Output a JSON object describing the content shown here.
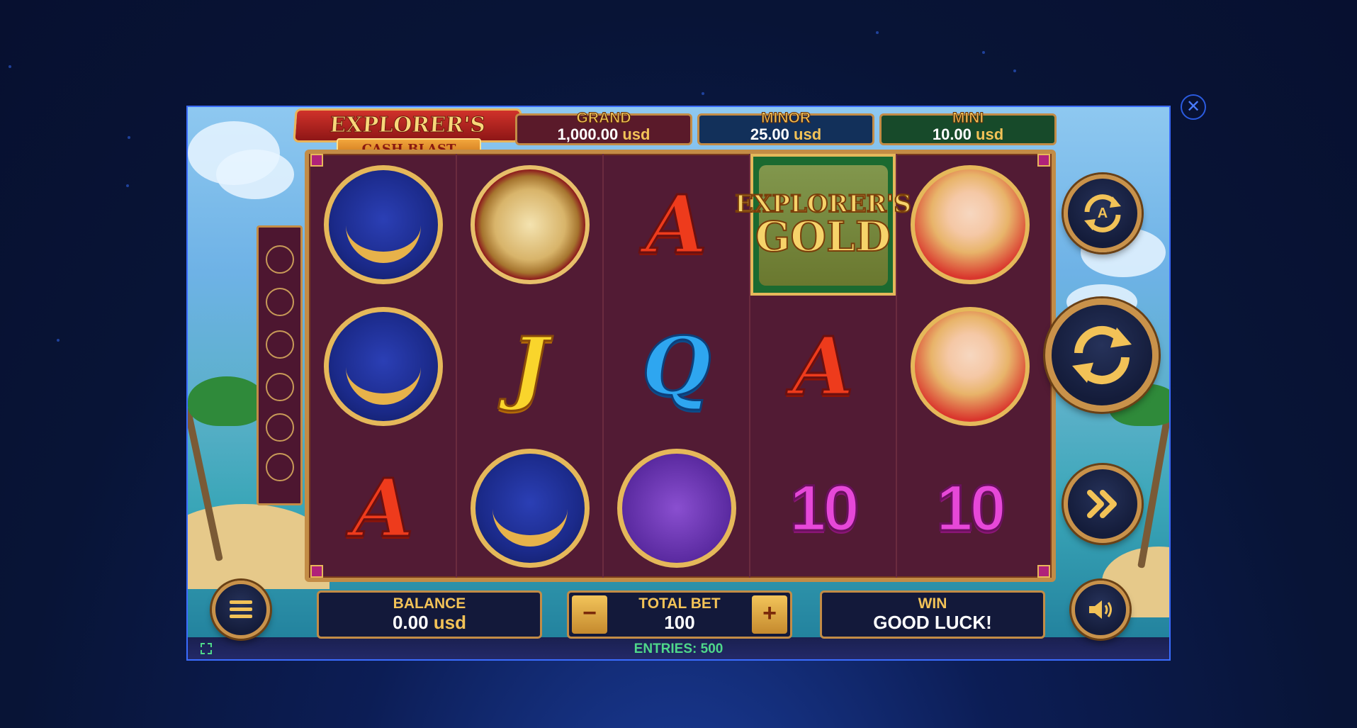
{
  "game": {
    "logo_line1": "EXPLORER'S GOLD",
    "logo_line2": "CASH BLAST"
  },
  "jackpots": [
    {
      "name": "GRAND",
      "amount": "1,000.00",
      "unit": "usd",
      "color": "#5a1a2a"
    },
    {
      "name": "MINOR",
      "amount": "25.00",
      "unit": "usd",
      "color": "#12305a"
    },
    {
      "name": "MINI",
      "amount": "10.00",
      "unit": "usd",
      "color": "#174a2a"
    }
  ],
  "reels": {
    "scatter_line1": "EXPLORER'S",
    "scatter_line2": "GOLD",
    "letter_a": "A",
    "letter_j": "J",
    "letter_q": "Q",
    "ten": "10"
  },
  "balance": {
    "label": "BALANCE",
    "amount": "0.00",
    "unit": "usd"
  },
  "bet": {
    "label": "TOTAL BET",
    "value": "100",
    "minus": "−",
    "plus": "+"
  },
  "win": {
    "label": "WIN",
    "value": "GOOD LUCK!"
  },
  "footer": {
    "entries": "ENTRIES: 500"
  },
  "icons": {
    "close": "close-icon",
    "autoplay": "autoplay-icon",
    "spin": "spin-icon",
    "turbo": "turbo-icon",
    "menu": "menu-icon",
    "sound": "sound-icon",
    "fullscreen": "fullscreen-icon"
  },
  "colors": {
    "accent": "#c38c46",
    "reel_bg": "#521b34",
    "entries": "#4fd88a",
    "frame_border": "#3a6cff"
  }
}
